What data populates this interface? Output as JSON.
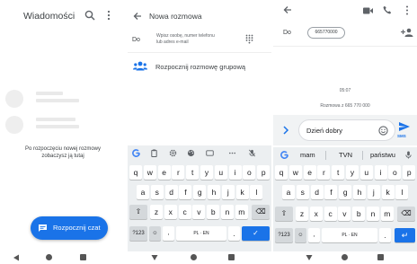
{
  "panel1": {
    "title": "Wiadomości",
    "empty_text_line1": "Po rozpoczęciu nowej rozmowy",
    "empty_text_line2": "zobaczysz ją tutaj",
    "fab_label": "Rozpocznij czat",
    "icons": [
      "search-icon",
      "more-vert-icon",
      "chat-icon"
    ]
  },
  "panel2": {
    "title": "Nowa rozmowa",
    "to_label": "Do",
    "to_hint_line1": "Wpisz osobę, numer telefonu",
    "to_hint_line2": "lub adres e-mail",
    "group_label": "Rozpocznij rozmowę grupową",
    "icons": [
      "back-arrow-icon",
      "dialpad-icon",
      "group-icon"
    ]
  },
  "panel3": {
    "to_label": "Do",
    "recipient_chip": "665770000",
    "time": "05:07",
    "conversation_with": "Rozmowa z 665 770 000",
    "message_text": "Dzień dobry",
    "send_label": "SMS",
    "icons": [
      "back-arrow-icon",
      "video-call-icon",
      "phone-icon",
      "more-vert-icon",
      "add-person-icon",
      "expand-icon",
      "emoji-icon",
      "send-icon"
    ]
  },
  "keyboard": {
    "toolbar_icons": [
      "google-g-icon",
      "clipboard-icon",
      "settings-icon",
      "palette-icon",
      "gif-icon",
      "more-icon",
      "mic-off-icon"
    ],
    "suggestions": [
      "mam",
      "TVN",
      "państwu"
    ],
    "row1": [
      "q",
      "w",
      "e",
      "r",
      "t",
      "y",
      "u",
      "i",
      "o",
      "p"
    ],
    "row2": [
      "a",
      "s",
      "d",
      "f",
      "g",
      "h",
      "j",
      "k",
      "l"
    ],
    "row3": [
      "z",
      "x",
      "c",
      "v",
      "b",
      "n",
      "m"
    ],
    "symbols_key": "?123",
    "comma_key": ",",
    "space_label": "PL · EN",
    "period_key": "."
  },
  "colors": {
    "accent": "#1a73e8",
    "keyboard_bg": "#eceff1",
    "text": "#3c4043"
  }
}
